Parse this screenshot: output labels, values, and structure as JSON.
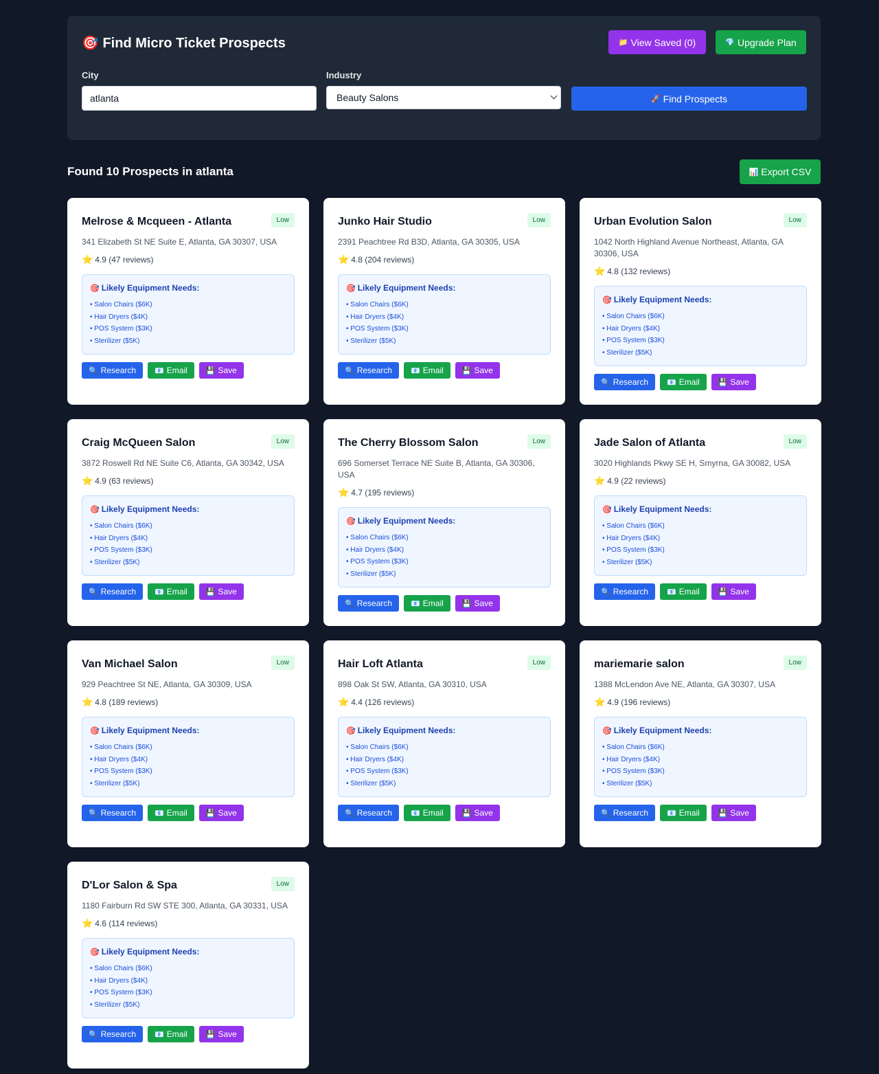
{
  "header": {
    "title": "Find Micro Ticket Prospects",
    "view_saved_label": "View Saved (0)",
    "upgrade_label": "Upgrade Plan"
  },
  "search": {
    "city_label": "City",
    "city_value": "atlanta",
    "industry_label": "Industry",
    "industry_value": "Beauty Salons",
    "find_label": "Find Prospects"
  },
  "results": {
    "heading": "Found 10 Prospects in atlanta",
    "export_label": "Export CSV"
  },
  "card_labels": {
    "needs_title": "Likely Equipment Needs:",
    "research": "Research",
    "email": "Email",
    "save": "Save"
  },
  "prospects": [
    {
      "name": "Melrose & Mcqueen - Atlanta",
      "badge": "Low",
      "address": "341 Elizabeth St NE Suite E, Atlanta, GA 30307, USA",
      "rating": "4.9 (47 reviews)",
      "needs": [
        "Salon Chairs ($6K)",
        "Hair Dryers ($4K)",
        "POS System ($3K)",
        "Sterilizer ($5K)"
      ]
    },
    {
      "name": "Junko Hair Studio",
      "badge": "Low",
      "address": "2391 Peachtree Rd B3D, Atlanta, GA 30305, USA",
      "rating": "4.8 (204 reviews)",
      "needs": [
        "Salon Chairs ($6K)",
        "Hair Dryers ($4K)",
        "POS System ($3K)",
        "Sterilizer ($5K)"
      ]
    },
    {
      "name": "Urban Evolution Salon",
      "badge": "Low",
      "address": "1042 North Highland Avenue Northeast, Atlanta, GA 30306, USA",
      "rating": "4.8 (132 reviews)",
      "needs": [
        "Salon Chairs ($6K)",
        "Hair Dryers ($4K)",
        "POS System ($3K)",
        "Sterilizer ($5K)"
      ]
    },
    {
      "name": "Craig McQueen Salon",
      "badge": "Low",
      "address": "3872 Roswell Rd NE Suite C6, Atlanta, GA 30342, USA",
      "rating": "4.9 (63 reviews)",
      "needs": [
        "Salon Chairs ($6K)",
        "Hair Dryers ($4K)",
        "POS System ($3K)",
        "Sterilizer ($5K)"
      ]
    },
    {
      "name": "The Cherry Blossom Salon",
      "badge": "Low",
      "address": "696 Somerset Terrace NE Suite B, Atlanta, GA 30306, USA",
      "rating": "4.7 (195 reviews)",
      "needs": [
        "Salon Chairs ($6K)",
        "Hair Dryers ($4K)",
        "POS System ($3K)",
        "Sterilizer ($5K)"
      ]
    },
    {
      "name": "Jade Salon of Atlanta",
      "badge": "Low",
      "address": "3020 Highlands Pkwy SE H, Smyrna, GA 30082, USA",
      "rating": "4.9 (22 reviews)",
      "needs": [
        "Salon Chairs ($6K)",
        "Hair Dryers ($4K)",
        "POS System ($3K)",
        "Sterilizer ($5K)"
      ]
    },
    {
      "name": "Van Michael Salon",
      "badge": "Low",
      "address": "929 Peachtree St NE, Atlanta, GA 30309, USA",
      "rating": "4.8 (189 reviews)",
      "needs": [
        "Salon Chairs ($6K)",
        "Hair Dryers ($4K)",
        "POS System ($3K)",
        "Sterilizer ($5K)"
      ]
    },
    {
      "name": "Hair Loft Atlanta",
      "badge": "Low",
      "address": "898 Oak St SW, Atlanta, GA 30310, USA",
      "rating": "4.4 (126 reviews)",
      "needs": [
        "Salon Chairs ($6K)",
        "Hair Dryers ($4K)",
        "POS System ($3K)",
        "Sterilizer ($5K)"
      ]
    },
    {
      "name": "mariemarie salon",
      "badge": "Low",
      "address": "1388 McLendon Ave NE, Atlanta, GA 30307, USA",
      "rating": "4.9 (196 reviews)",
      "needs": [
        "Salon Chairs ($6K)",
        "Hair Dryers ($4K)",
        "POS System ($3K)",
        "Sterilizer ($5K)"
      ]
    },
    {
      "name": "D'Lor Salon & Spa",
      "badge": "Low",
      "address": "1180 Fairburn Rd SW STE 300, Atlanta, GA 30331, USA",
      "rating": "4.6 (114 reviews)",
      "needs": [
        "Salon Chairs ($6K)",
        "Hair Dryers ($4K)",
        "POS System ($3K)",
        "Sterilizer ($5K)"
      ]
    }
  ],
  "icons": {
    "target": "target-icon",
    "folder": "folder-icon",
    "gem": "gem-icon",
    "rocket": "rocket-icon",
    "chart": "bar-chart-icon",
    "star": "star-icon",
    "search": "magnifier-icon",
    "email": "envelope-icon",
    "save": "floppy-disk-icon"
  },
  "colors": {
    "background": "#111827",
    "panel": "#1f2937",
    "primary": "#2563eb",
    "success": "#16a34a",
    "purple": "#9333ea"
  }
}
